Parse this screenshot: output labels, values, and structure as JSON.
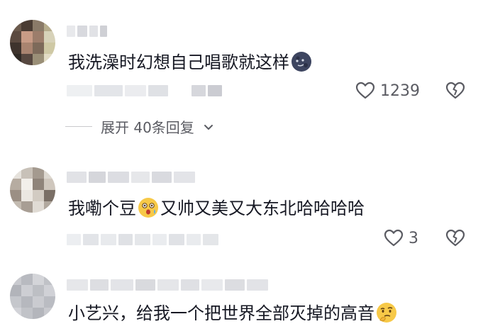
{
  "comments": [
    {
      "text": "我洗澡时幻想自己唱歌就这样",
      "emoji_icons": [
        "moon-face-icon"
      ],
      "like_count": "1239"
    },
    {
      "text_before": "我嘞个豆",
      "emoji_icons": [
        "astonished-face-icon"
      ],
      "text_after": "又帅又美又大东北哈哈哈哈",
      "like_count": "3"
    },
    {
      "text": "小艺兴，给我一个把世界全部灭掉的高音",
      "emoji_icons": [
        "thinking-face-icon"
      ]
    }
  ],
  "replies": {
    "expand_label": "展开 40条回复"
  },
  "colors": {
    "text": "#161823",
    "meta": "#5a5b62"
  }
}
